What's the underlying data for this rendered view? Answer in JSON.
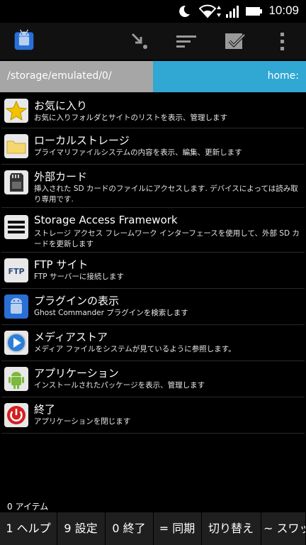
{
  "status_bar": {
    "time": "10:09",
    "icons": [
      "moon-icon",
      "wifi-icon",
      "signal-icon",
      "battery-icon"
    ]
  },
  "action_bar": {
    "icons": [
      "app-logo-icon",
      "arrow-down-right-icon",
      "sort-icon",
      "checkbox-icon",
      "overflow-menu-icon"
    ]
  },
  "path_bar": {
    "left_path": "/storage/emulated/0/",
    "right_path": "home:"
  },
  "items": [
    {
      "title": "お気に入り",
      "desc": "お気に入りフォルダとサイトのリストを表示、管理します",
      "icon": "star-icon"
    },
    {
      "title": "ローカルストレージ",
      "desc": "プライマリファイルシステムの内容を表示、編集、更新します",
      "icon": "folder-icon"
    },
    {
      "title": "外部カード",
      "desc": "挿入された SD カードのファイルにアクセスします. デバイスによっては読み取り専用です.",
      "icon": "sd-card-icon"
    },
    {
      "title": "Storage Access Framework",
      "desc": "ストレージ アクセス フレームワーク インターフェースを使用して、外部 SD カードを更新します",
      "icon": "menu-lines-icon"
    },
    {
      "title": "FTP サイト",
      "desc": "FTP サーバーに接続します",
      "icon": "ftp-icon"
    },
    {
      "title": "プラグインの表示",
      "desc": "Ghost Commander プラグインを検索します",
      "icon": "android-plugin-icon"
    },
    {
      "title": "メディアストア",
      "desc": "メディア ファイルをシステムが見ているように参照します。",
      "icon": "play-icon"
    },
    {
      "title": "アプリケーション",
      "desc": "インストールされたパッケージを表示、管理します",
      "icon": "android-icon"
    },
    {
      "title": "終了",
      "desc": "アプリケーションを閉じます",
      "icon": "power-icon"
    }
  ],
  "item_count": "0 アイテム",
  "toolbar": {
    "buttons": [
      "1 ヘルプ",
      "9 設定",
      "0 終了",
      "= 同期",
      "切り替え",
      "~ スワップ"
    ]
  }
}
